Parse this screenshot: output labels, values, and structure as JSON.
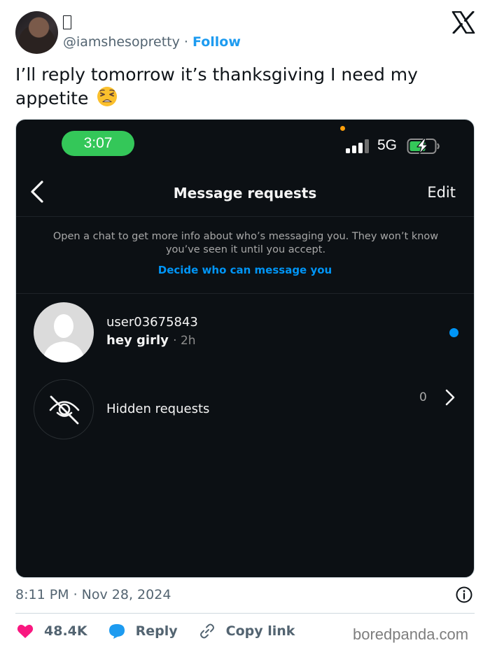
{
  "tweet": {
    "author_name_glyph": "",
    "handle": "@iamshesopretty",
    "separator": "·",
    "follow_label": "Follow",
    "text": "I’ll reply tomorrow it’s thanksgiving I need my appetite",
    "emoji": "weary-face-emoji",
    "timestamp": "8:11 PM · Nov 28, 2024"
  },
  "phone": {
    "status_time": "3:07",
    "network": "5G",
    "title": "Message requests",
    "edit_label": "Edit",
    "info_text": "Open a chat to get more info about who’s messaging you. They won’t know you’ve seen it until you accept.",
    "decide_link": "Decide who can message you",
    "request": {
      "username": "user03675843",
      "message": "hey girly",
      "time": "· 2h"
    },
    "hidden": {
      "label": "Hidden requests",
      "count": "0"
    }
  },
  "actions": {
    "likes": "48.4K",
    "reply_label": "Reply",
    "copy_label": "Copy link"
  },
  "watermark": "boredpanda.com",
  "colors": {
    "follow_blue": "#1d9bf0",
    "ig_blue": "#0095f6",
    "like_pink": "#f91880",
    "status_green": "#34c759",
    "phone_bg": "#0c1014"
  }
}
